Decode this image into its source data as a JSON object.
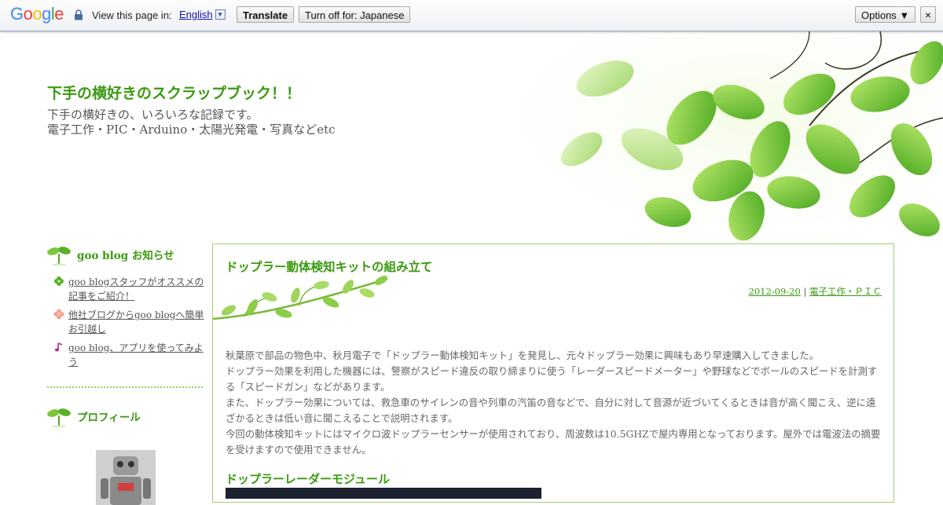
{
  "translate_bar": {
    "logo": [
      "G",
      "o",
      "o",
      "g",
      "l",
      "e"
    ],
    "label": "View this page in:",
    "language": "English",
    "translate_button": "Translate",
    "turn_off_button": "Turn off for: Japanese",
    "options_button": "Options ▼",
    "close_button": "×"
  },
  "header": {
    "title": "下手の横好きのスクラップブック！！",
    "description_line1": "下手の横好きの、いろいろな記録です。",
    "description_line2": "電子工作・PIC・Arduino・太陽光発電・写真などetc"
  },
  "sidebar": {
    "notice": {
      "title": "goo blog お知らせ",
      "items": [
        {
          "label": "goo blogスタッフがオススメの記事をご紹介！",
          "icon": "clover-icon"
        },
        {
          "label": "他社ブログからgoo blogへ簡単お引越し",
          "icon": "flower-icon"
        },
        {
          "label": "goo blog、アプリを使ってみよう",
          "icon": "music-note-icon"
        }
      ]
    },
    "profile": {
      "title": "プロフィール"
    }
  },
  "entry": {
    "title": "ドップラー動体検知キットの組み立て",
    "date": "2012-09-20",
    "separator": "|",
    "category": "電子工作・ＰＩＣ",
    "paragraphs": [
      "秋葉原で部品の物色中、秋月電子で「ドップラー動体検知キット」を発見し、元々ドップラー効果に興味もあり早速購入してきました。",
      "ドップラー効果を利用した機器には、警察がスピード違反の取り締まりに使う「レーダースピードメーター」や野球などでボールのスピードを計測する「スピードガン」などがあります。",
      "また、ドップラー効果については、救急車のサイレンの音や列車の汽笛の音などで、自分に対して音源が近づいてくるときは音が高く聞こえ、逆に遠ざかるときは低い音に聞こえることで説明されます。",
      "今回の動体検知キットにはマイクロ波ドップラーセンサーが使用されており、周波数は10.5GHZで屋内専用となっております。屋外では電波法の摘要を受けますので使用できません。"
    ],
    "sub_heading": "ドップラーレーダーモジュール"
  },
  "colors": {
    "accent_green": "#3a9a10",
    "border_green": "#a5cf70",
    "text_gray": "#666666"
  }
}
